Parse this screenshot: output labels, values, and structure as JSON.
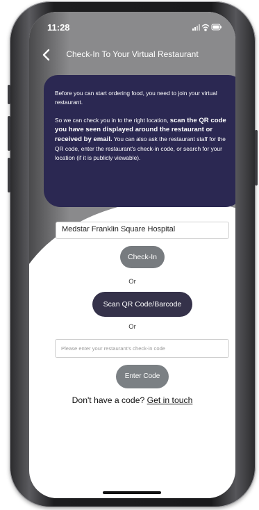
{
  "status_bar": {
    "time": "11:28"
  },
  "nav": {
    "title": "Check-In To Your Virtual Restaurant"
  },
  "info_card": {
    "para1": "Before you can start ordering food, you need to join your virtual restaurant.",
    "para2_start": "So we can check you in to the right location, ",
    "para2_bold": "scan the QR code you have seen displayed around the restaurant or received by email.",
    "para2_end": " You can also ask the restaurant staff for the QR code, enter the restaurant's check-in code, or search for your location (if it is publicly viewable)."
  },
  "location_input": {
    "value": "Medstar Franklin Square Hospital"
  },
  "buttons": {
    "check_in": "Check-In",
    "scan": "Scan QR Code/Barcode",
    "enter_code": "Enter Code"
  },
  "or_label_1": "Or",
  "or_label_2": "Or",
  "code_input": {
    "placeholder": "Please enter your restaurant's check-in code"
  },
  "footer": {
    "question": "Don't have a code? ",
    "link": "Get in touch"
  },
  "colors": {
    "card": "#2b2852",
    "scan_button": "#35324a",
    "grey_button": "#777b7f"
  }
}
